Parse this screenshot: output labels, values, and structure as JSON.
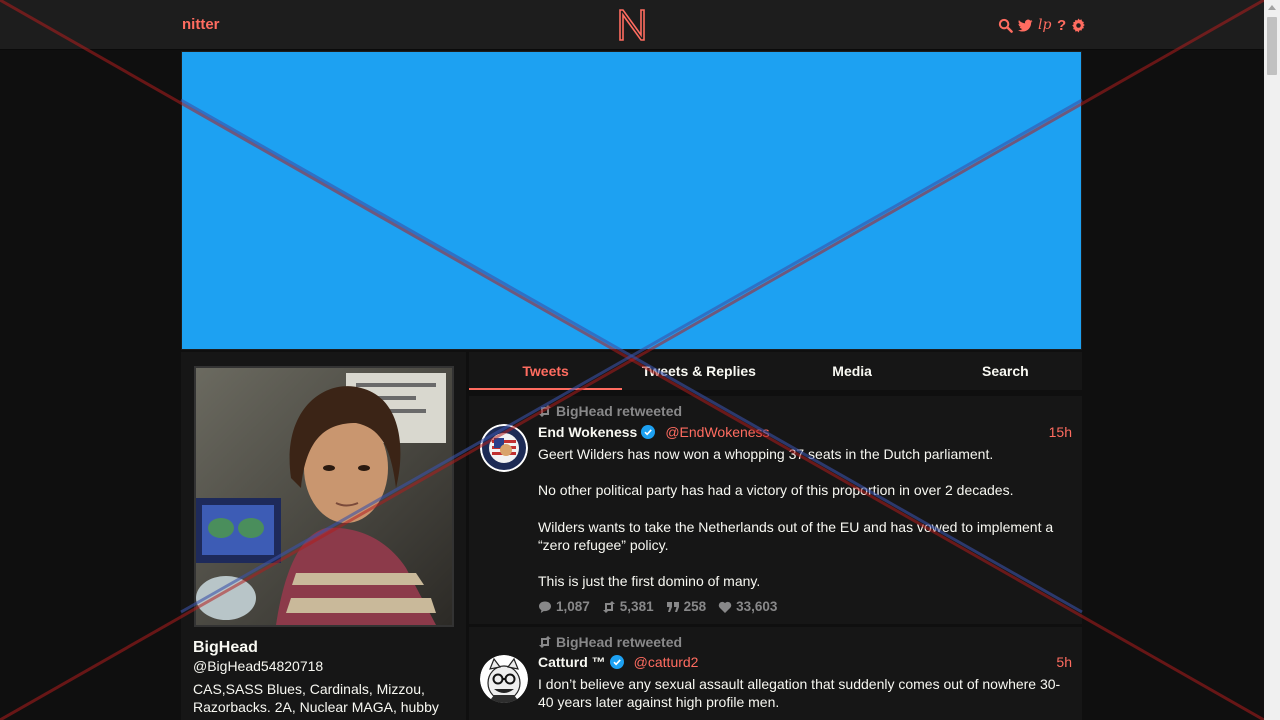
{
  "navbar": {
    "brand": "nitter",
    "logo_letter": "N",
    "icons": [
      "search-icon",
      "twitter-bird-icon",
      "liberapay-icon",
      "help-icon",
      "gear-icon"
    ],
    "help_glyph": "?",
    "lp_glyph": "lp"
  },
  "banner": {
    "color": "#1da1f2"
  },
  "profile": {
    "fullname": "BigHead",
    "username": "@BigHead54820718",
    "bio": "CAS,SASS Blues, Cardinals, Mizzou, Razorbacks. 2A, Nuclear MAGA, hubby"
  },
  "tabs": [
    {
      "label": "Tweets",
      "active": true
    },
    {
      "label": "Tweets & Replies",
      "active": false
    },
    {
      "label": "Media",
      "active": false
    },
    {
      "label": "Search",
      "active": false
    }
  ],
  "tweets": [
    {
      "retweet_label": "BigHead retweeted",
      "fullname": "End Wokeness",
      "username": "@EndWokeness",
      "date": "15h",
      "paragraphs": [
        "Geert Wilders has now won a whopping 37 seats in the Dutch parliament.",
        "No other political party has had a victory of this proportion in over 2 decades.",
        "Wilders wants to take the Netherlands out of the EU and has vowed to implement a “zero refugee” policy.",
        "This is just the first domino of many."
      ],
      "stats": {
        "replies": "1,087",
        "retweets": "5,381",
        "quotes": "258",
        "likes": "33,603"
      }
    },
    {
      "retweet_label": "BigHead retweeted",
      "fullname": "Catturd ™",
      "username": "@catturd2",
      "date": "5h",
      "paragraphs": [
        "I don’t believe any sexual assault allegation that suddenly comes out of nowhere 30-40 years later against high profile men."
      ]
    }
  ],
  "colors": {
    "accent": "#ff6c60",
    "background": "#0f0f0f",
    "panel": "#161616",
    "muted": "#888889",
    "verified": "#1da1f2",
    "overlay_red": "#b01e1e",
    "overlay_blue": "#3a52a8"
  }
}
